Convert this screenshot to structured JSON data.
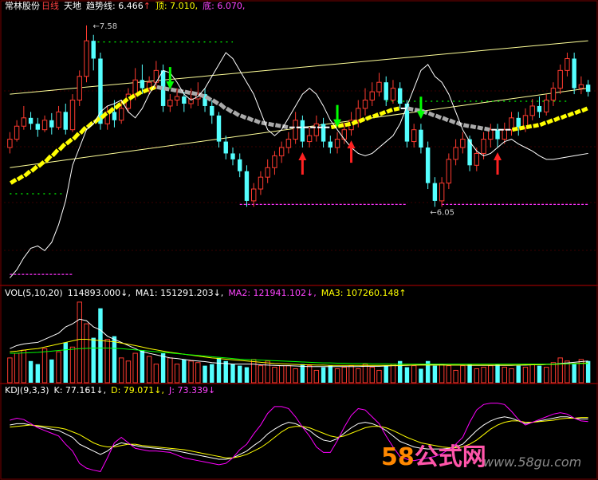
{
  "header": {
    "stock_name": "常林股份",
    "period": "日线",
    "indicator_name": "天地",
    "trend_label": "趋势线: 6.466",
    "trend_arrow": "↑",
    "top_label": "顶: 7.010,",
    "bottom_label": "底: 6.070,"
  },
  "vol_header": {
    "title": "VOL(5,10,20)",
    "vol": "114893.000↓,",
    "ma1": "MA1: 151291.203↓,",
    "ma2": "MA2: 121941.102↓,",
    "ma3": "MA3: 107260.148↑"
  },
  "kdj_header": {
    "title": "KDJ(9,3,3)",
    "k": "K: 77.161↓,",
    "d": "D: 79.071↓,",
    "j": "J: 73.339↓"
  },
  "watermark": {
    "num": "58",
    "text": "公式网",
    "url": "www.58gu.com"
  },
  "colors": {
    "up": "#ff3b30",
    "down": "#54ffff",
    "grid": "#7a0000",
    "trend_yellow": "#ffff00",
    "trend_white": "#ffffff",
    "trend_gray": "#aaaaaa",
    "channel": "#ffff99",
    "price_line": "#ffffff",
    "vol_ma1": "#ffffff",
    "vol_ma2": "#ffff00",
    "vol_ma3": "#00ff00",
    "kdj_k": "#ffffff",
    "kdj_d": "#ffff00",
    "kdj_j": "#ff00ff",
    "support": "#ff33ff",
    "resistance": "#00ff00",
    "arrow_buy": "#ff2222",
    "arrow_sell": "#00ff00"
  },
  "chart_data": {
    "type": "candlestick",
    "price_range": [
      5.4,
      7.7
    ],
    "annotations": {
      "high_label": "7.58",
      "low_label": "6.05",
      "high_value": 7.58,
      "low_value": 6.05
    },
    "candles": [
      [
        6.55,
        6.62,
        6.5,
        6.68
      ],
      [
        6.62,
        6.73,
        6.6,
        6.78
      ],
      [
        6.73,
        6.8,
        6.7,
        6.9
      ],
      [
        6.8,
        6.75,
        6.7,
        6.85
      ],
      [
        6.75,
        6.7,
        6.64,
        6.8
      ],
      [
        6.7,
        6.78,
        6.68,
        6.82
      ],
      [
        6.78,
        6.72,
        6.66,
        6.84
      ],
      [
        6.72,
        6.85,
        6.7,
        6.9
      ],
      [
        6.85,
        6.7,
        6.66,
        6.92
      ],
      [
        6.7,
        6.95,
        6.68,
        7.0
      ],
      [
        6.95,
        7.15,
        6.9,
        7.2
      ],
      [
        7.15,
        7.45,
        7.1,
        7.58
      ],
      [
        7.45,
        7.3,
        7.2,
        7.5
      ],
      [
        7.3,
        6.75,
        6.7,
        7.35
      ],
      [
        6.75,
        6.85,
        6.7,
        6.9
      ],
      [
        6.85,
        6.78,
        6.72,
        6.95
      ],
      [
        6.78,
        6.88,
        6.75,
        6.95
      ],
      [
        6.88,
        7.0,
        6.85,
        7.05
      ],
      [
        7.0,
        7.12,
        6.95,
        7.22
      ],
      [
        7.12,
        7.05,
        7.0,
        7.25
      ],
      [
        7.05,
        7.1,
        7.0,
        7.15
      ],
      [
        7.1,
        7.2,
        7.05,
        7.28
      ],
      [
        7.2,
        6.9,
        6.85,
        7.25
      ],
      [
        6.9,
        6.95,
        6.85,
        7.0
      ],
      [
        6.95,
        6.98,
        6.9,
        7.05
      ],
      [
        6.98,
        6.92,
        6.85,
        7.02
      ],
      [
        6.92,
        6.96,
        6.88,
        7.05
      ],
      [
        6.96,
        7.0,
        6.9,
        7.1
      ],
      [
        7.0,
        6.9,
        6.85,
        7.05
      ],
      [
        6.9,
        6.82,
        6.75,
        6.95
      ],
      [
        6.82,
        6.6,
        6.55,
        6.85
      ],
      [
        6.6,
        6.5,
        6.45,
        6.65
      ],
      [
        6.5,
        6.45,
        6.4,
        6.55
      ],
      [
        6.45,
        6.35,
        6.3,
        6.5
      ],
      [
        6.35,
        6.1,
        6.05,
        6.4
      ],
      [
        6.1,
        6.2,
        6.05,
        6.25
      ],
      [
        6.2,
        6.3,
        6.15,
        6.35
      ],
      [
        6.3,
        6.38,
        6.25,
        6.45
      ],
      [
        6.38,
        6.48,
        6.32,
        6.52
      ],
      [
        6.48,
        6.55,
        6.42,
        6.6
      ],
      [
        6.55,
        6.62,
        6.5,
        6.68
      ],
      [
        6.62,
        6.78,
        6.58,
        6.85
      ],
      [
        6.78,
        6.6,
        6.55,
        6.82
      ],
      [
        6.6,
        6.65,
        6.55,
        6.72
      ],
      [
        6.65,
        6.75,
        6.6,
        6.82
      ],
      [
        6.75,
        6.6,
        6.55,
        6.8
      ],
      [
        6.6,
        6.55,
        6.5,
        6.65
      ],
      [
        6.55,
        6.62,
        6.5,
        6.68
      ],
      [
        6.62,
        6.7,
        6.58,
        6.76
      ],
      [
        6.7,
        6.78,
        6.65,
        6.85
      ],
      [
        6.78,
        6.88,
        6.72,
        6.95
      ],
      [
        6.88,
        6.95,
        6.82,
        7.05
      ],
      [
        6.95,
        7.02,
        6.9,
        7.1
      ],
      [
        7.02,
        7.1,
        6.98,
        7.18
      ],
      [
        7.1,
        6.95,
        6.9,
        7.15
      ],
      [
        6.95,
        7.05,
        6.92,
        7.12
      ],
      [
        7.05,
        6.92,
        6.88,
        7.1
      ],
      [
        6.92,
        6.6,
        6.55,
        6.95
      ],
      [
        6.6,
        6.7,
        6.55,
        6.75
      ],
      [
        6.7,
        6.55,
        6.5,
        6.75
      ],
      [
        6.55,
        6.25,
        6.2,
        6.6
      ],
      [
        6.25,
        6.1,
        6.05,
        6.3
      ],
      [
        6.1,
        6.25,
        6.05,
        6.3
      ],
      [
        6.25,
        6.45,
        6.2,
        6.5
      ],
      [
        6.45,
        6.55,
        6.4,
        6.62
      ],
      [
        6.55,
        6.62,
        6.5,
        6.68
      ],
      [
        6.62,
        6.4,
        6.35,
        6.65
      ],
      [
        6.4,
        6.5,
        6.35,
        6.55
      ],
      [
        6.5,
        6.62,
        6.45,
        6.68
      ],
      [
        6.62,
        6.7,
        6.55,
        6.75
      ],
      [
        6.7,
        6.62,
        6.55,
        6.75
      ],
      [
        6.62,
        6.7,
        6.58,
        6.76
      ],
      [
        6.7,
        6.8,
        6.65,
        6.85
      ],
      [
        6.8,
        6.72,
        6.65,
        6.85
      ],
      [
        6.72,
        6.82,
        6.68,
        6.88
      ],
      [
        6.82,
        6.9,
        6.78,
        6.96
      ],
      [
        6.9,
        6.85,
        6.8,
        6.98
      ],
      [
        6.85,
        6.95,
        6.82,
        7.0
      ],
      [
        6.95,
        7.05,
        6.9,
        7.1
      ],
      [
        7.05,
        7.2,
        7.0,
        7.25
      ],
      [
        7.2,
        7.3,
        7.15,
        7.35
      ],
      [
        7.3,
        7.05,
        7.0,
        7.35
      ],
      [
        7.05,
        7.08,
        7.0,
        7.15
      ],
      [
        7.08,
        7.02,
        6.98,
        7.12
      ]
    ],
    "trendline": [
      6.25,
      6.28,
      6.31,
      6.35,
      6.39,
      6.43,
      6.48,
      6.53,
      6.58,
      6.62,
      6.67,
      6.72,
      6.76,
      6.8,
      6.84,
      6.88,
      6.92,
      6.96,
      6.99,
      7.02,
      7.04,
      7.06,
      7.05,
      7.04,
      7.03,
      7.02,
      7.01,
      7.0,
      6.98,
      6.95,
      6.92,
      6.88,
      6.85,
      6.82,
      6.8,
      6.78,
      6.76,
      6.75,
      6.74,
      6.73,
      6.72,
      6.72,
      6.72,
      6.72,
      6.72,
      6.72,
      6.72,
      6.73,
      6.74,
      6.75,
      6.77,
      6.79,
      6.81,
      6.83,
      6.85,
      6.87,
      6.88,
      6.88,
      6.87,
      6.86,
      6.84,
      6.82,
      6.8,
      6.78,
      6.76,
      6.74,
      6.73,
      6.72,
      6.71,
      6.7,
      6.7,
      6.7,
      6.7,
      6.71,
      6.72,
      6.73,
      6.74,
      6.76,
      6.78,
      6.8,
      6.82,
      6.84,
      6.86,
      6.88
    ],
    "price_line": [
      5.45,
      5.52,
      5.62,
      5.7,
      5.72,
      5.68,
      5.75,
      5.9,
      6.1,
      6.4,
      6.55,
      6.7,
      6.75,
      6.85,
      6.9,
      6.92,
      6.95,
      6.85,
      6.8,
      6.88,
      7.0,
      7.1,
      7.2,
      7.18,
      7.1,
      7.0,
      6.95,
      6.98,
      7.05,
      7.15,
      7.25,
      7.35,
      7.3,
      7.2,
      7.1,
      7.0,
      6.85,
      6.7,
      6.65,
      6.7,
      6.8,
      6.9,
      7.0,
      7.05,
      7.0,
      6.9,
      6.78,
      6.7,
      6.62,
      6.55,
      6.5,
      6.48,
      6.5,
      6.55,
      6.6,
      6.65,
      6.75,
      6.9,
      7.05,
      7.2,
      7.25,
      7.15,
      7.1,
      7.0,
      6.85,
      6.7,
      6.6,
      6.52,
      6.48,
      6.5,
      6.55,
      6.6,
      6.62,
      6.58,
      6.55,
      6.52,
      6.48,
      6.45,
      6.45,
      6.46,
      6.47,
      6.48,
      6.49,
      6.5
    ],
    "channel_upper": [
      [
        0,
        7.0
      ],
      [
        83,
        7.45
      ]
    ],
    "channel_lower": [
      [
        0,
        6.38
      ],
      [
        83,
        7.05
      ]
    ],
    "support_lines": [
      {
        "value": 6.07,
        "start": 33,
        "end": 57
      },
      {
        "value": 6.07,
        "start": 62,
        "end": 83
      },
      {
        "value": 5.48,
        "start": 0,
        "end": 9
      }
    ],
    "resistance_lines": [
      {
        "value": 7.44,
        "start": 11,
        "end": 32
      },
      {
        "value": 6.94,
        "start": 54,
        "end": 80
      },
      {
        "value": 6.16,
        "start": 0,
        "end": 8
      }
    ],
    "buy_arrows": [
      42,
      49,
      70
    ],
    "sell_arrows": [
      23,
      47,
      59
    ],
    "volume": {
      "values": [
        80,
        95,
        105,
        70,
        60,
        110,
        75,
        100,
        130,
        115,
        260,
        190,
        145,
        240,
        140,
        150,
        80,
        70,
        95,
        105,
        85,
        60,
        95,
        80,
        60,
        75,
        70,
        65,
        55,
        60,
        80,
        70,
        60,
        55,
        50,
        75,
        55,
        70,
        50,
        55,
        55,
        45,
        60,
        55,
        40,
        50,
        55,
        45,
        50,
        55,
        45,
        60,
        50,
        40,
        55,
        60,
        70,
        50,
        55,
        45,
        70,
        55,
        60,
        55,
        40,
        55,
        60,
        45,
        50,
        55,
        60,
        50,
        45,
        55,
        50,
        60,
        55,
        50,
        65,
        80,
        70,
        60,
        75,
        70
      ],
      "ma1": [
        110,
        120,
        125,
        128,
        130,
        140,
        150,
        160,
        180,
        190,
        205,
        200,
        180,
        170,
        150,
        140,
        130,
        120,
        110,
        100,
        95,
        90,
        85,
        80,
        78,
        75,
        72,
        70,
        68,
        65,
        63,
        62,
        60,
        60,
        60,
        60,
        58,
        57,
        56,
        55,
        55,
        54,
        53,
        52,
        52,
        52,
        52,
        52,
        52,
        52,
        52,
        53,
        53,
        53,
        54,
        55,
        55,
        56,
        57,
        58,
        58,
        58,
        58,
        57,
        57,
        57,
        56,
        56,
        56,
        56,
        56,
        56,
        56,
        57,
        57,
        58,
        58,
        59,
        60,
        62,
        64,
        66,
        68,
        70
      ],
      "ma2": [
        100,
        102,
        105,
        108,
        110,
        115,
        120,
        125,
        130,
        135,
        140,
        140,
        138,
        136,
        134,
        132,
        128,
        124,
        120,
        115,
        110,
        106,
        102,
        98,
        95,
        92,
        89,
        86,
        83,
        80,
        78,
        76,
        74,
        72,
        70,
        68,
        66,
        64,
        62,
        61,
        60,
        59,
        58,
        58,
        57,
        57,
        56,
        56,
        56,
        56,
        56,
        56,
        56,
        56,
        56,
        56,
        56,
        57,
        57,
        57,
        57,
        57,
        57,
        57,
        57,
        57,
        57,
        57,
        57,
        57,
        57,
        57,
        57,
        57,
        58,
        58,
        58,
        59,
        59,
        60,
        61,
        62,
        63,
        64
      ],
      "ma3": [
        95,
        95,
        96,
        97,
        98,
        100,
        102,
        104,
        106,
        108,
        110,
        111,
        112,
        112,
        112,
        111,
        110,
        108,
        106,
        104,
        102,
        100,
        98,
        96,
        94,
        92,
        90,
        88,
        86,
        84,
        82,
        80,
        78,
        76,
        75,
        74,
        73,
        72,
        71,
        70,
        69,
        68,
        67,
        66,
        65,
        64,
        64,
        63,
        63,
        62,
        62,
        62,
        61,
        61,
        61,
        60,
        60,
        60,
        60,
        60,
        60,
        60,
        60,
        60,
        60,
        60,
        60,
        60,
        60,
        60,
        60,
        60,
        60,
        60,
        60,
        60,
        60,
        60,
        60,
        61,
        61,
        61,
        62,
        62
      ],
      "max": 270
    },
    "kdj": {
      "range": [
        -10,
        110
      ],
      "k": [
        68,
        70,
        70,
        68,
        66,
        64,
        62,
        60,
        55,
        50,
        40,
        35,
        30,
        25,
        30,
        38,
        42,
        40,
        38,
        36,
        35,
        34,
        33,
        32,
        30,
        28,
        26,
        24,
        22,
        20,
        18,
        18,
        20,
        25,
        30,
        38,
        45,
        55,
        62,
        68,
        72,
        70,
        65,
        60,
        52,
        46,
        44,
        48,
        56,
        64,
        70,
        72,
        70,
        66,
        60,
        52,
        44,
        40,
        36,
        34,
        33,
        33,
        33,
        34,
        36,
        40,
        50,
        60,
        68,
        74,
        78,
        80,
        78,
        74,
        70,
        72,
        74,
        76,
        78,
        80,
        80,
        78,
        77,
        77
      ],
      "d": [
        65,
        66,
        67,
        68,
        67,
        66,
        65,
        64,
        62,
        58,
        54,
        48,
        42,
        38,
        36,
        36,
        38,
        40,
        40,
        38,
        37,
        36,
        35,
        34,
        33,
        32,
        30,
        28,
        26,
        24,
        22,
        20,
        20,
        22,
        25,
        30,
        35,
        42,
        50,
        58,
        64,
        66,
        66,
        64,
        60,
        56,
        52,
        50,
        52,
        56,
        60,
        64,
        66,
        66,
        64,
        60,
        55,
        50,
        46,
        42,
        40,
        38,
        36,
        35,
        35,
        36,
        40,
        46,
        54,
        62,
        68,
        72,
        74,
        74,
        72,
        72,
        73,
        74,
        75,
        77,
        78,
        78,
        79,
        79
      ],
      "j": [
        75,
        78,
        76,
        70,
        64,
        60,
        56,
        52,
        40,
        30,
        12,
        5,
        2,
        0,
        20,
        42,
        50,
        42,
        34,
        32,
        30,
        30,
        29,
        28,
        24,
        20,
        18,
        16,
        14,
        12,
        10,
        12,
        20,
        32,
        40,
        55,
        68,
        85,
        95,
        95,
        92,
        80,
        65,
        52,
        36,
        28,
        28,
        45,
        65,
        82,
        92,
        90,
        80,
        70,
        52,
        36,
        22,
        18,
        16,
        18,
        20,
        22,
        26,
        32,
        40,
        50,
        72,
        90,
        98,
        100,
        100,
        98,
        88,
        76,
        68,
        72,
        76,
        80,
        84,
        86,
        84,
        78,
        74,
        73
      ]
    }
  }
}
